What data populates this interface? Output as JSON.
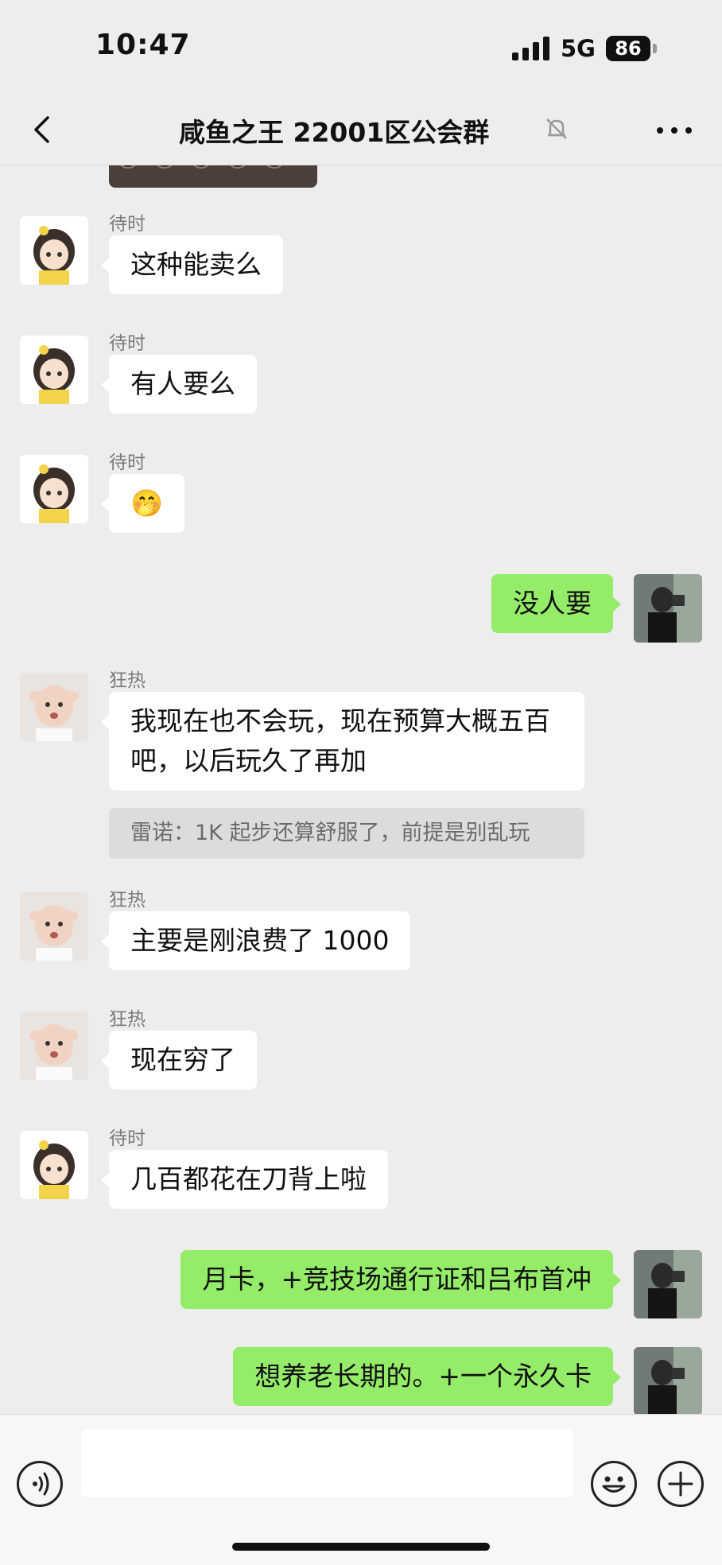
{
  "status_bar": {
    "time": "10:47",
    "network": "5G",
    "battery": "86"
  },
  "nav": {
    "title": "咸鱼之王 22001区公会群"
  },
  "messages": [
    {
      "side": "left",
      "sender": "待时",
      "text": "这种能卖么",
      "avatar": "anime-girl-avatar"
    },
    {
      "side": "left",
      "sender": "待时",
      "text": "有人要么",
      "avatar": "anime-girl-avatar"
    },
    {
      "side": "left",
      "sender": "待时",
      "text": "🤭",
      "avatar": "anime-girl-avatar"
    },
    {
      "side": "right",
      "text": "没人要",
      "avatar": "self-photo-avatar"
    },
    {
      "side": "left",
      "sender": "狂热",
      "text": "我现在也不会玩，现在预算大概五百吧，以后玩久了再加",
      "quote": "雷诺：1K 起步还算舒服了，前提是别乱玩",
      "avatar": "baby-avatar"
    },
    {
      "side": "left",
      "sender": "狂热",
      "text": "主要是刚浪费了 1000",
      "avatar": "baby-avatar"
    },
    {
      "side": "left",
      "sender": "狂热",
      "text": "现在穷了",
      "avatar": "baby-avatar"
    },
    {
      "side": "left",
      "sender": "待时",
      "text": "几百都花在刀背上啦",
      "avatar": "anime-girl-avatar"
    },
    {
      "side": "right",
      "text": "月卡，+竞技场通行证和吕布首冲",
      "avatar": "self-photo-avatar"
    },
    {
      "side": "right",
      "text": "想养老长期的。+一个永久卡",
      "avatar": "self-photo-avatar"
    }
  ],
  "input_bar": {
    "value": ""
  },
  "icons": {
    "back": "chevron-left-icon",
    "mute": "bell-slash-icon",
    "more": "more-dots-icon",
    "voice": "voice-icon",
    "emoji": "emoji-icon",
    "plus": "plus-icon"
  },
  "colors": {
    "background": "#ededed",
    "self_bubble": "#95ec69",
    "other_bubble": "#ffffff",
    "quote": "#dcdcdc"
  }
}
